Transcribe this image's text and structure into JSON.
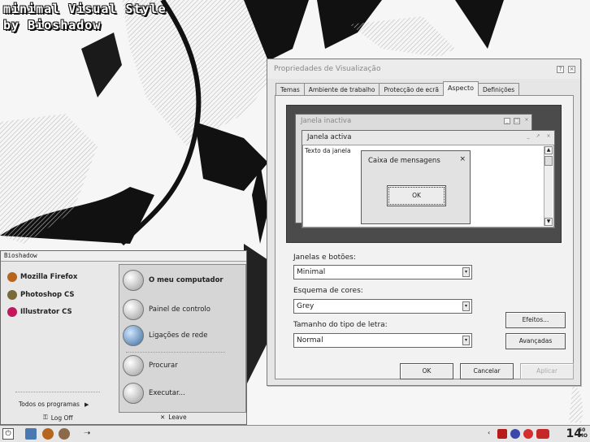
{
  "wallpaper": {
    "line1": "minimal Visual Style",
    "line2": "by Bioshadow"
  },
  "dialog": {
    "title": "Propriedades de Visualização",
    "tabs": [
      "Temas",
      "Ambiente de trabalho",
      "Protecção de ecrã",
      "Aspecto",
      "Definições"
    ],
    "active_tab": "Aspecto",
    "preview": {
      "inactive_title": "Janela inactiva",
      "active_title": "Janela activa",
      "window_text": "Texto da janela",
      "msgbox_title": "Caixa de mensagens",
      "msgbox_ok": "OK"
    },
    "windows_buttons_label": "Janelas e botões:",
    "windows_buttons_value": "Minimal",
    "color_scheme_label": "Esquema de cores:",
    "color_scheme_value": "Grey",
    "font_size_label": "Tamanho do tipo de letra:",
    "font_size_value": "Normal",
    "effects_button": "Efeitos...",
    "advanced_button": "Avançadas",
    "ok_button": "OK",
    "cancel_button": "Cancelar",
    "apply_button": "Aplicar"
  },
  "start_menu": {
    "user": "Bioshadow",
    "pinned": [
      {
        "label": "Mozilla Firefox",
        "icon": "firefox-icon",
        "color": "#b5651d"
      },
      {
        "label": "Photoshop CS",
        "icon": "photoshop-icon",
        "color": "#7a6a3a"
      },
      {
        "label": "Illustrator CS",
        "icon": "illustrator-icon",
        "color": "#c2185b"
      }
    ],
    "all_programs": "Todos os programas",
    "log_off": "Log Off",
    "leave": "Leave",
    "right_items": [
      {
        "label": "O meu computador",
        "icon": "computer-icon"
      },
      {
        "label": "Painel de controlo",
        "icon": "control-panel-icon"
      },
      {
        "label": "Ligações de rede",
        "icon": "network-icon"
      },
      {
        "label": "Procurar",
        "icon": "search-icon"
      },
      {
        "label": "Executar...",
        "icon": "run-icon"
      }
    ]
  },
  "taskbar": {
    "clock_hour": "14",
    "clock_min": "50",
    "clock_suffix": "MO"
  }
}
